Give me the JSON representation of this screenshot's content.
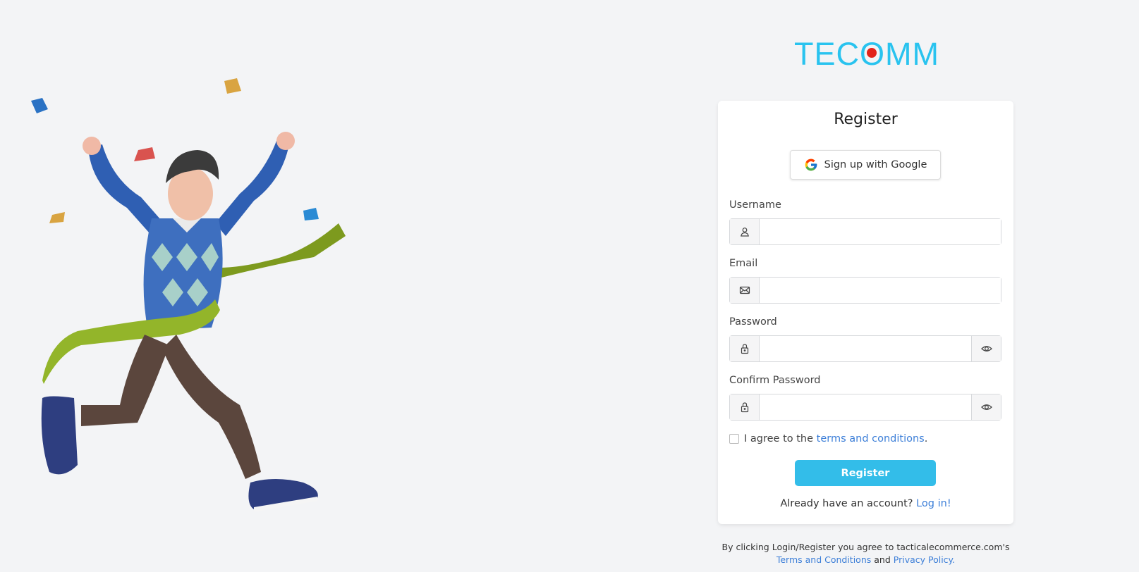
{
  "brand": {
    "logo_text": "TECOMM",
    "accent": "#29c3ef",
    "dot": "#e2231a"
  },
  "card": {
    "title": "Register",
    "google_button": "Sign up with Google",
    "fields": {
      "username": {
        "label": "Username",
        "icon": "user-icon",
        "value": ""
      },
      "email": {
        "label": "Email",
        "icon": "envelope-icon",
        "value": ""
      },
      "password": {
        "label": "Password",
        "icon": "lock-icon",
        "toggle_icon": "eye-icon",
        "value": ""
      },
      "confirm_password": {
        "label": "Confirm Password",
        "icon": "lock-icon",
        "toggle_icon": "eye-icon",
        "value": ""
      }
    },
    "terms": {
      "prefix": "I agree to the",
      "link": "terms and conditions",
      "suffix": ".",
      "checked": false
    },
    "register_button": "Register",
    "login_prompt": {
      "text": "Already have an account?",
      "link": "Log in!"
    }
  },
  "footer": {
    "line1": "By clicking Login/Register you agree to tacticalecommerce.com's",
    "terms_link": "Terms and Conditions",
    "and": "and",
    "privacy_link": "Privacy Policy."
  },
  "colors": {
    "primary_button": "#33bde9",
    "link": "#3d7fd8",
    "background": "#f3f4f6"
  }
}
